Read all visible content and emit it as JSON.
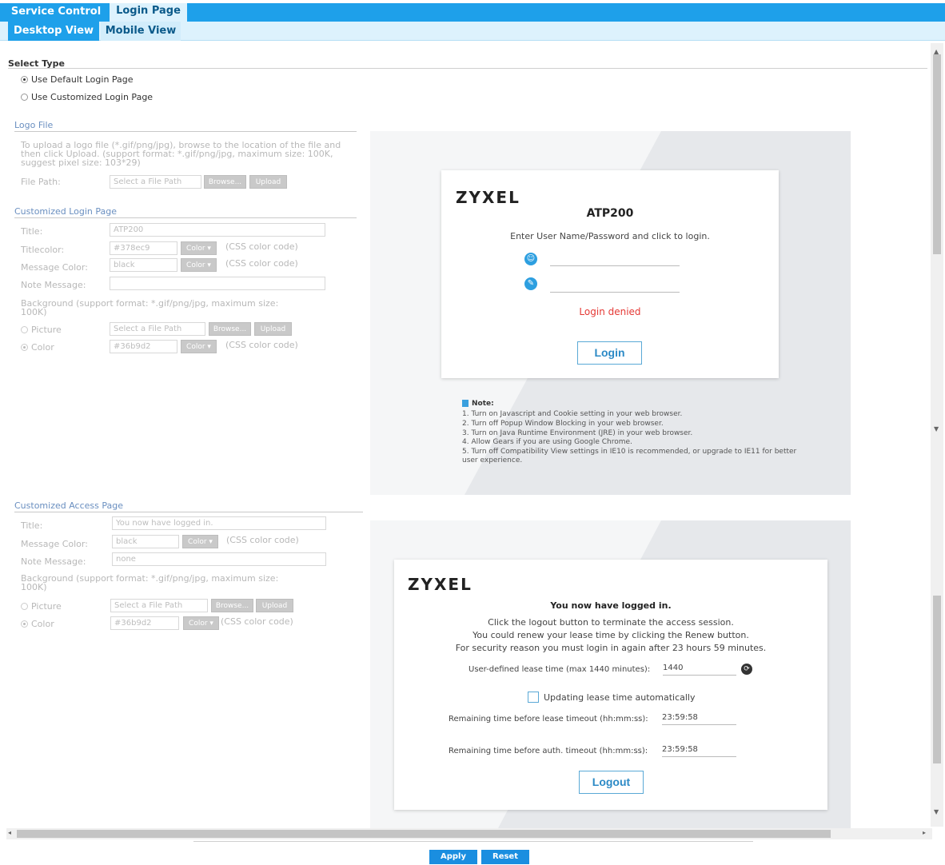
{
  "tabs": {
    "top": [
      {
        "label": "Service Control",
        "active": true
      },
      {
        "label": "Login Page",
        "active": false
      }
    ],
    "sub": [
      {
        "label": "Desktop View",
        "active": true
      },
      {
        "label": "Mobile View",
        "active": false
      }
    ]
  },
  "select_type": {
    "title": "Select Type",
    "options": [
      {
        "label": "Use Default Login Page",
        "selected": true
      },
      {
        "label": "Use Customized Login Page",
        "selected": false
      }
    ]
  },
  "logo_file": {
    "title": "Logo File",
    "desc": [
      "To upload a logo file (*.gif/png/jpg), browse to the location of the file and",
      "then click Upload. (support format: *.gif/png/jpg, maximum size: 100K,",
      "suggest pixel size: 103*29)"
    ],
    "file_path_label": "File Path:",
    "file_path_placeholder": "Select a File Path",
    "browse": "Browse...",
    "upload": "Upload"
  },
  "customized_login": {
    "title": "Customized Login Page",
    "title_label": "Title:",
    "title_value": "ATP200",
    "titlecolor_label": "Titlecolor:",
    "titlecolor_value": "#378ec9",
    "message_color_label": "Message Color:",
    "message_color_value": "black",
    "note_label": "Note Message:",
    "note_value": "",
    "color_btn": "Color",
    "css_hint": "(CSS color code)",
    "bg_label": [
      "Background (support format: *.gif/png/jpg, maximum size:",
      "100K)"
    ],
    "picture_label": "Picture",
    "picture_placeholder": "Select a File Path",
    "color_label": "Color",
    "color_value": "#36b9d2",
    "browse": "Browse...",
    "upload": "Upload"
  },
  "customized_access": {
    "title": "Customized Access Page",
    "title_label": "Title:",
    "title_value": "You now have logged in.",
    "message_color_label": "Message Color:",
    "message_color_value": "black",
    "note_label": "Note Message:",
    "note_value": "none",
    "color_btn": "Color",
    "css_hint": "(CSS color code)",
    "bg_label": [
      "Background (support format: *.gif/png/jpg, maximum size:",
      "100K)"
    ],
    "picture_label": "Picture",
    "picture_placeholder": "Select a File Path",
    "color_label": "Color",
    "color_value": "#36b9d2",
    "browse": "Browse...",
    "upload": "Upload"
  },
  "login_preview": {
    "logo": "ZYXEL",
    "title": "ATP200",
    "instruction": "Enter User Name/Password and click to login.",
    "error": "Login denied",
    "button": "Login",
    "note_title": "Note:",
    "notes": [
      "1. Turn on Javascript and Cookie setting in your web browser.",
      "2. Turn off Popup Window Blocking in your web browser.",
      "3. Turn on Java Runtime Environment (JRE) in your web browser.",
      "4. Allow Gears if you are using Google Chrome.",
      "5. Turn off Compatibility View settings in IE10 is recommended, or upgrade to IE11 for better",
      "user experience."
    ]
  },
  "access_preview": {
    "logo": "ZYXEL",
    "title": "You now have logged in.",
    "lines": [
      "Click the logout button to terminate the access session.",
      "You could renew your lease time by clicking the Renew button.",
      "For security reason you must login in again after 23 hours 59 minutes."
    ],
    "lease_label": "User-defined lease time (max 1440 minutes):",
    "lease_value": "1440",
    "auto_label": "Updating lease time automatically",
    "remain_lease_label": "Remaining time before lease timeout (hh:mm:ss):",
    "remain_lease_value": "23:59:58",
    "remain_auth_label": "Remaining time before auth. timeout (hh:mm:ss):",
    "remain_auth_value": "23:59:58",
    "button": "Logout"
  },
  "footer": {
    "apply": "Apply",
    "reset": "Reset"
  },
  "colors": {
    "accent": "#1ea0ea",
    "tab_active": "#1ea0ea",
    "tab_inactive": "#ddf2fd",
    "login_error": "#e53935",
    "login_title": "#222222"
  }
}
